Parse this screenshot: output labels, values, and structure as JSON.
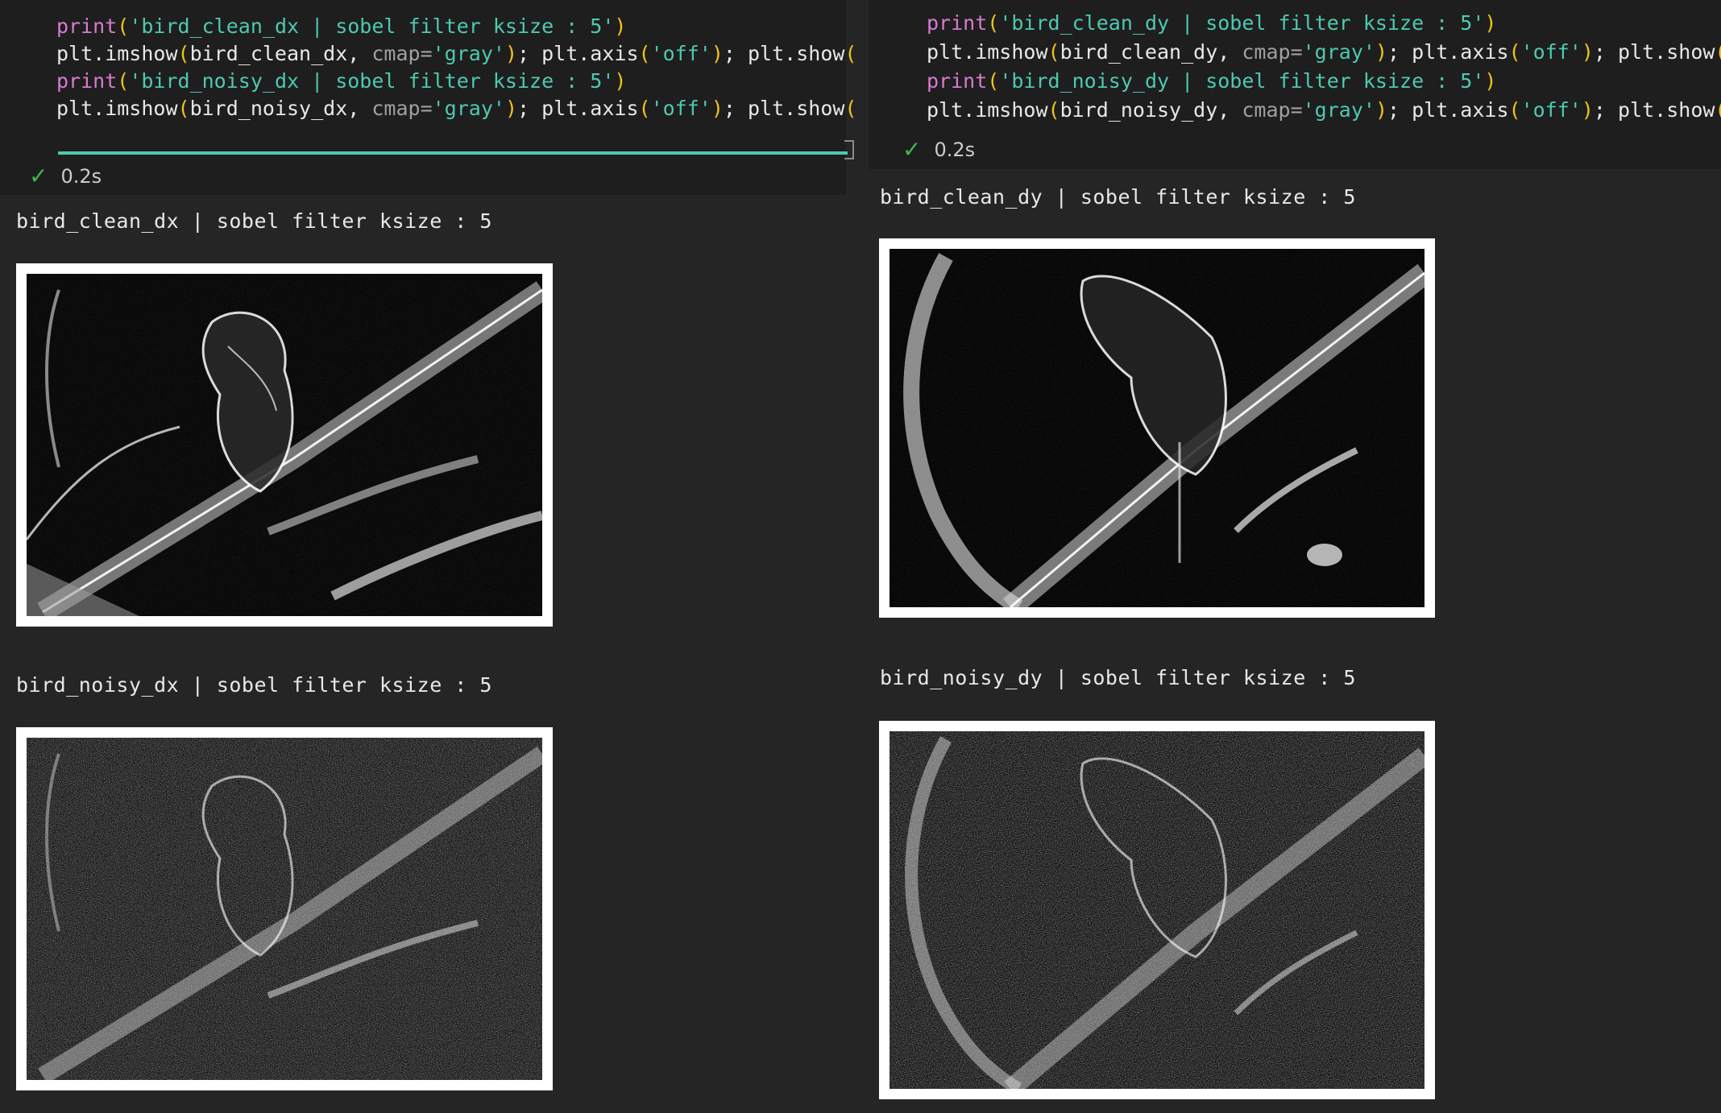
{
  "left": {
    "code": {
      "line1": {
        "fn": "print",
        "open": "(",
        "str": "'bird_clean_dx | sobel filter ksize : 5'",
        "close": ")"
      },
      "line2": {
        "pre": "plt.imshow",
        "open": "(",
        "arg": "bird_clean_dx, ",
        "kw": "cmap=",
        "str": "'gray'",
        "close": ")",
        "mid": "; plt.axis",
        "open2": "(",
        "str2": "'off'",
        "close2": ")",
        "tail": "; plt.show",
        "call": "()"
      },
      "line3": {
        "fn": "print",
        "open": "(",
        "str": "'bird_noisy_dx | sobel filter ksize : 5'",
        "close": ")"
      },
      "line4": {
        "pre": "plt.imshow",
        "open": "(",
        "arg": "bird_noisy_dx, ",
        "kw": "cmap=",
        "str": "'gray'",
        "close": ")",
        "mid": "; plt.axis",
        "open2": "(",
        "str2": "'off'",
        "close2": ")",
        "tail": "; plt.show",
        "call": "()"
      }
    },
    "status_time": "0.2s",
    "outputs": [
      {
        "label": "bird_clean_dx | sobel filter ksize : 5"
      },
      {
        "label": "bird_noisy_dx | sobel filter ksize : 5"
      }
    ]
  },
  "right": {
    "code": {
      "line1": {
        "fn": "print",
        "open": "(",
        "str": "'bird_clean_dy | sobel filter ksize : 5'",
        "close": ")"
      },
      "line2": {
        "pre": "plt.imshow",
        "open": "(",
        "arg": "bird_clean_dy, ",
        "kw": "cmap=",
        "str": "'gray'",
        "close": ")",
        "mid": "; plt.axis",
        "open2": "(",
        "str2": "'off'",
        "close2": ")",
        "tail": "; plt.show",
        "call": "()"
      },
      "line3": {
        "fn": "print",
        "open": "(",
        "str": "'bird_noisy_dy | sobel filter ksize : 5'",
        "close": ")"
      },
      "line4": {
        "pre": "plt.imshow",
        "open": "(",
        "arg": "bird_noisy_dy, ",
        "kw": "cmap=",
        "str": "'gray'",
        "close": ")",
        "mid": "; plt.axis",
        "open2": "(",
        "str2": "'off'",
        "close2": ")",
        "tail": "; plt.show",
        "call": "()"
      }
    },
    "status_time": "0.2s",
    "outputs": [
      {
        "label": "bird_clean_dy | sobel filter ksize : 5"
      },
      {
        "label": "bird_noisy_dy | sobel filter ksize : 5"
      }
    ]
  },
  "icons": {
    "status": "check-icon"
  },
  "colors": {
    "background": "#252526",
    "code_background": "#1e1e1e",
    "function": "#d77bd1",
    "string": "#4ec9b0",
    "bracket": "#f0c419",
    "success": "#3fb950",
    "progress": "#4ec9b0"
  }
}
